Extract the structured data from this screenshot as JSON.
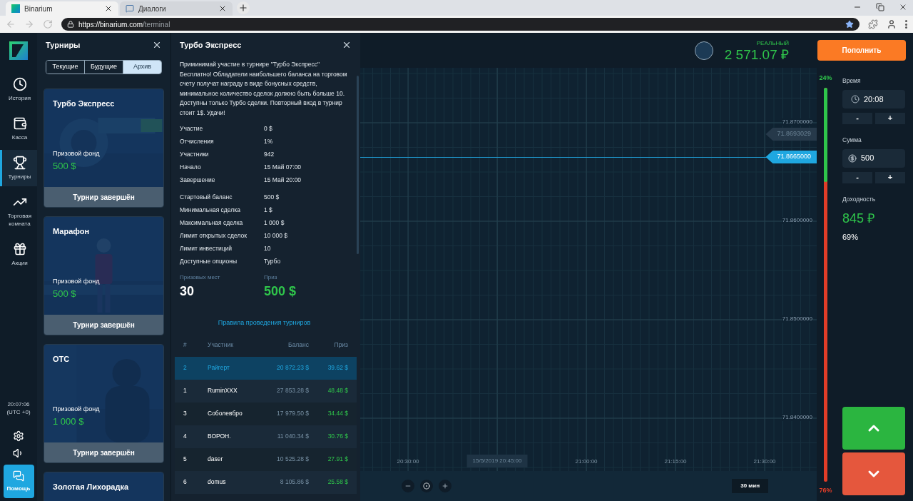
{
  "browser": {
    "tabs": [
      {
        "title": "Binarium",
        "selected": true
      },
      {
        "title": "Диалоги",
        "selected": false
      }
    ],
    "url_host": "https://binarium.com",
    "url_path": "/terminal"
  },
  "nav": {
    "items": [
      {
        "label": "История",
        "selected": false
      },
      {
        "label": "Касса",
        "selected": false
      },
      {
        "label": "Турниры",
        "selected": true
      },
      {
        "label": "Торговая комната",
        "selected": false
      },
      {
        "label": "Акции",
        "selected": false
      }
    ],
    "time": "20:07:06",
    "zone": "(UTC +0)",
    "help": "Помощь"
  },
  "tournaments": {
    "title": "Турниры",
    "filters": [
      {
        "label": "Текущие",
        "selected": false
      },
      {
        "label": "Будущие",
        "selected": false
      },
      {
        "label": "Архив",
        "selected": true
      }
    ],
    "cards": [
      {
        "title": "Турбо Экспресс",
        "fund_label": "Призовой фонд",
        "fund": "500 $",
        "status": "Турнир завершён",
        "kind": "picture"
      },
      {
        "title": "Марафон",
        "fund_label": "Призовой фонд",
        "fund": "500 $",
        "status": "Турнир завершён",
        "kind": "picture"
      },
      {
        "title": "OTC",
        "fund_label": "Призовой фонд",
        "fund": "1 000 $",
        "status": "Турнир завершён",
        "kind": "picture"
      },
      {
        "title": "Золотая Лихорадка",
        "kind": "picture"
      }
    ]
  },
  "detail": {
    "title": "Турбо Экспресс",
    "description": "Приминимай участие в турнире \"Турбо Экспресс\" Бесплатно! Обладатели наибольшего баланса на торговом счету получат награду в виде бонусных средств, минимальное количество сделок должно быть больше 10. Доступны только Турбо сделки. Повторный вход в турнир стоит 1$. Удачи!",
    "info_groups": [
      [
        {
          "label": "Участие",
          "value": "0 $"
        },
        {
          "label": "Отчисления",
          "value": "1%"
        },
        {
          "label": "Участники",
          "value": "942"
        },
        {
          "label": "Начало",
          "value": "15 Май 07:00"
        },
        {
          "label": "Завершение",
          "value": "15 Май 20:00"
        }
      ],
      [
        {
          "label": "Стартовый баланс",
          "value": "500 $"
        },
        {
          "label": "Минимальная сделка",
          "value": "1 $"
        },
        {
          "label": "Максимальная сделка",
          "value": "1 000 $"
        },
        {
          "label": "Лимит открытых сделок",
          "value": "10 000 $"
        },
        {
          "label": "Лимит инвестиций",
          "value": "10"
        },
        {
          "label": "Доступные опционы",
          "value": "Турбо"
        }
      ]
    ],
    "prize_places_label": "Призовых мест",
    "prize_places": "30",
    "prize_label": "Приз",
    "prize": "500 $",
    "rules_link": "Правила проведения турниров",
    "leaderboard": {
      "columns": [
        "#",
        "Участник",
        "Баланс",
        "Приз"
      ],
      "rows": [
        {
          "place": "2",
          "name": "Райгерт",
          "balance": "20 872.23 $",
          "prize": "39.62 $",
          "selected": true
        },
        {
          "place": "1",
          "name": "RuminXXX",
          "balance": "27 853.28 $",
          "prize": "48.48 $",
          "selected": false
        },
        {
          "place": "3",
          "name": "Соболевбро",
          "balance": "17 979.50 $",
          "prize": "34.44 $",
          "selected": false
        },
        {
          "place": "4",
          "name": "ВОРОН.",
          "balance": "11 040.34 $",
          "prize": "30.76 $",
          "selected": false
        },
        {
          "place": "5",
          "name": "daser",
          "balance": "10 525.28 $",
          "prize": "27.91 $",
          "selected": false
        },
        {
          "place": "6",
          "name": "domus",
          "balance": "8 105.86 $",
          "prize": "25.58 $",
          "selected": false
        }
      ]
    }
  },
  "chart": {
    "y_labels": [
      "71.8700000",
      "71.8600000",
      "71.8500000",
      "71.8400000"
    ],
    "markers": [
      {
        "price": "71.8693029",
        "kind": "previous"
      },
      {
        "price": "71.8665000",
        "kind": "current"
      }
    ],
    "x_labels": [
      {
        "text": "20:30:00",
        "kind": "tick"
      },
      {
        "text": "15/5/2019 20:45:00",
        "kind": "cursor"
      },
      {
        "text": "21:00:00",
        "kind": "tick"
      },
      {
        "text": "21:15:00",
        "kind": "tick"
      },
      {
        "text": "21:30:00",
        "kind": "tick"
      }
    ],
    "period": "30 мин"
  },
  "account": {
    "type": "РЕАЛЬНЫЙ",
    "balance": "2 571.07 ₽",
    "deposit": "Пополнить"
  },
  "sentiment": {
    "up": "24%",
    "down": "76%",
    "level": 0.24
  },
  "trade": {
    "time_label": "Время",
    "time": "20:08",
    "amount_label": "Сумма",
    "amount": "500",
    "minus": "-",
    "plus": "+",
    "payout_label": "Доходность",
    "payout": "845 ₽",
    "payout_percent": "69%"
  }
}
